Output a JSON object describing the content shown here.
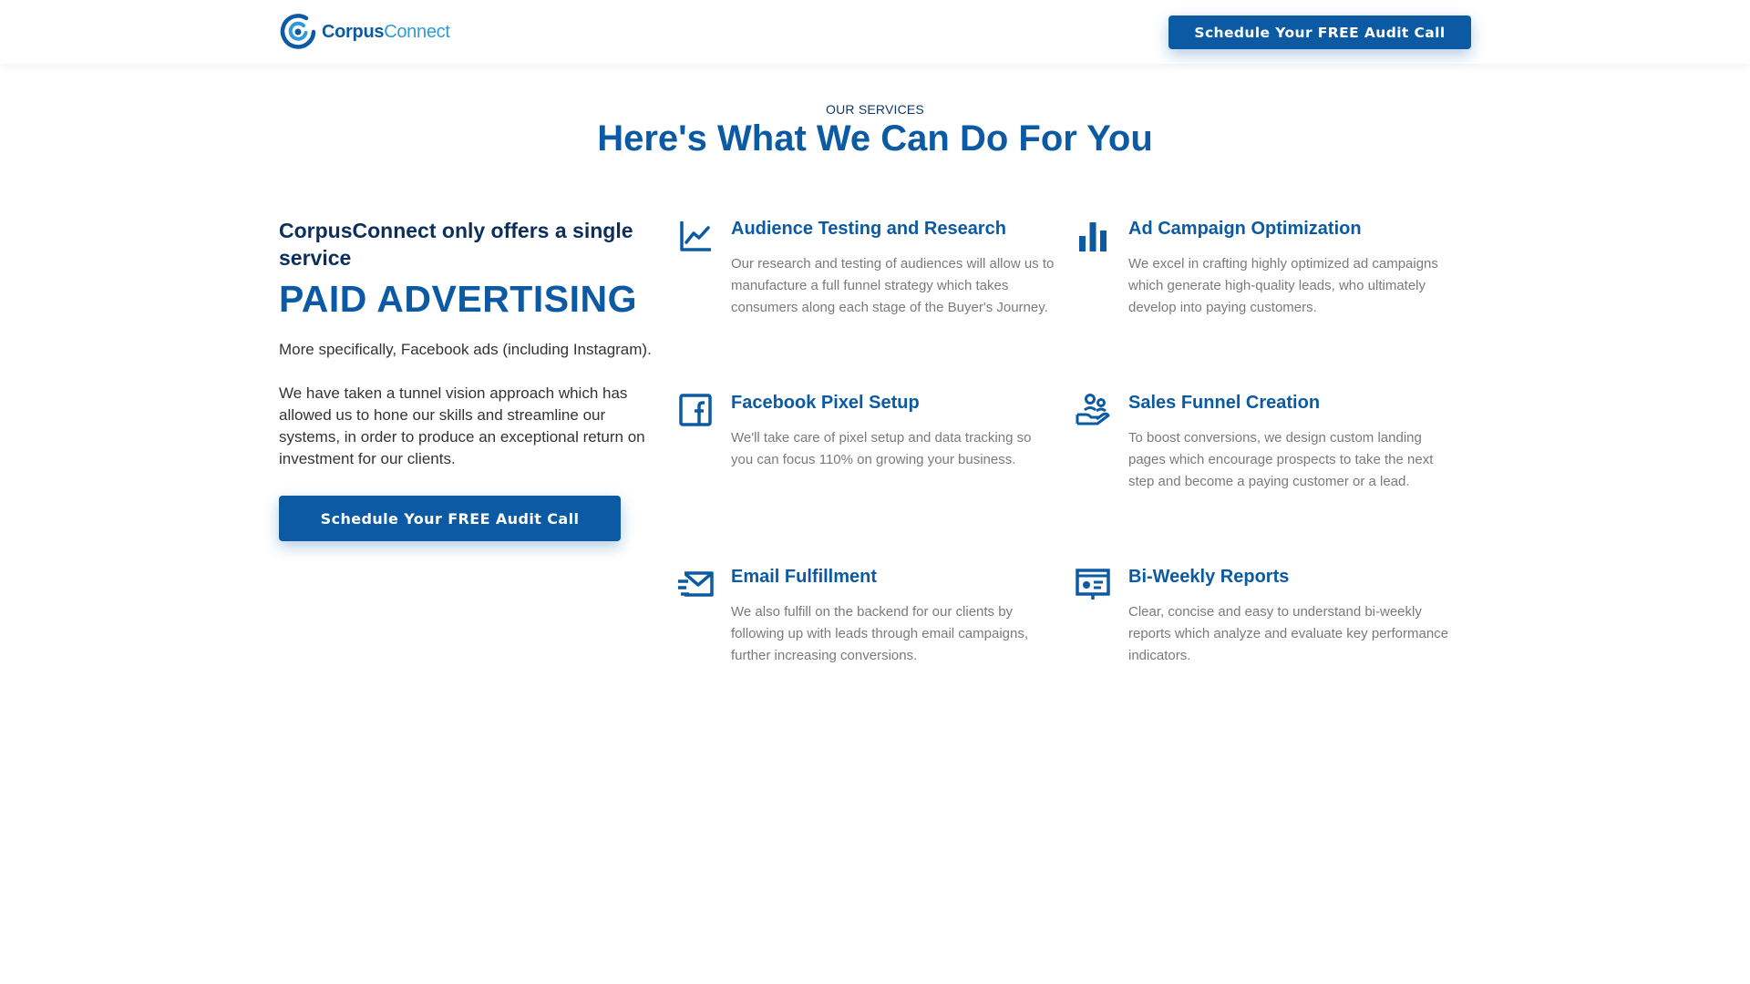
{
  "header": {
    "logo_part1": "Corpus",
    "logo_part2": "Connect",
    "cta_label": "Schedule Your FREE Audit Call"
  },
  "section": {
    "eyebrow": "OUR SERVICES",
    "title": "Here's What We Can Do For You"
  },
  "intro": {
    "lead": "CorpusConnect only offers a single service",
    "headline": "PAID ADVERTISING",
    "paragraph1": "More specifically, Facebook ads (including Instagram).",
    "paragraph2": "We have taken a tunnel vision approach which has allowed us to hone our skills and streamline our systems, in order to produce an exceptional return on investment for our clients.",
    "cta_label": "Schedule Your FREE Audit Call"
  },
  "services": [
    {
      "icon": "line-chart-icon",
      "title": "Audience Testing and Research",
      "description": "Our research and testing of audiences will allow us to manufacture a full funnel strategy which takes consumers along each stage of the Buyer's Journey."
    },
    {
      "icon": "bar-chart-icon",
      "title": "Ad Campaign Optimization",
      "description": "We excel in crafting highly optimized ad campaigns which generate high-quality leads, who ultimately develop into paying customers."
    },
    {
      "icon": "facebook-icon",
      "title": "Facebook Pixel Setup",
      "description": "We'll take care of pixel setup and data tracking so you can focus 110% on growing your business."
    },
    {
      "icon": "hand-holding-people-icon",
      "title": "Sales Funnel Creation",
      "description": "To boost conversions, we design custom landing pages which encourage prospects to take the next step and become a paying customer or a lead."
    },
    {
      "icon": "envelope-fast-icon",
      "title": "Email Fulfillment",
      "description": "We also fulfill on the backend for our clients by following up with leads through email campaigns, further increasing conversions."
    },
    {
      "icon": "report-screen-icon",
      "title": "Bi-Weekly Reports",
      "description": "Clear, concise and easy to understand bi-weekly reports which analyze and evaluate key performance indicators."
    }
  ],
  "colors": {
    "brand_dark": "#0b5aa3",
    "brand_light": "#2f9ad9",
    "navy_text": "#0a2f5c",
    "body_grey": "#7a7a7a"
  }
}
